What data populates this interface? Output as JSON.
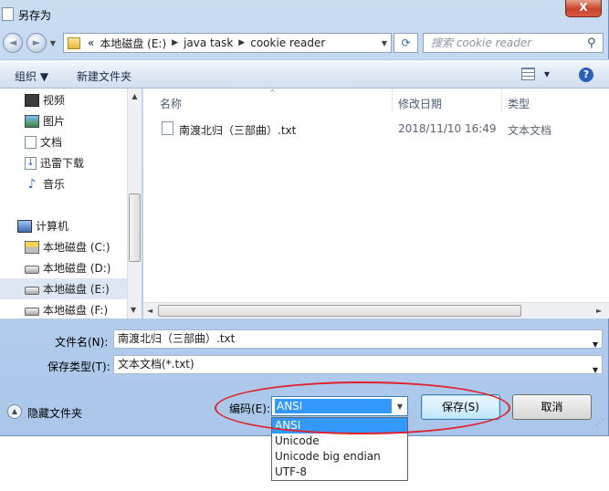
{
  "window": {
    "title": "另存为",
    "close_label": "X"
  },
  "nav": {
    "back_arrow": "◄",
    "fwd_arrow": "►",
    "address": {
      "prefix": "«",
      "crumbs": [
        "本地磁盘 (E:)",
        "java task",
        "cookie reader"
      ]
    },
    "search_placeholder": "搜索 cookie reader"
  },
  "toolbar": {
    "organize": "组织 ▼",
    "new_folder": "新建文件夹",
    "view_toggle": "▾"
  },
  "sidebar": {
    "items": [
      {
        "label": "视频",
        "icon": "video-icon"
      },
      {
        "label": "图片",
        "icon": "picture-icon"
      },
      {
        "label": "文档",
        "icon": "document-icon"
      },
      {
        "label": "迅雷下载",
        "icon": "download-icon"
      },
      {
        "label": "音乐",
        "icon": "music-icon"
      },
      {
        "label": "计算机",
        "icon": "computer-icon"
      },
      {
        "label": "本地磁盘 (C:)",
        "icon": "windows-drive-icon"
      },
      {
        "label": "本地磁盘 (D:)",
        "icon": "drive-icon"
      },
      {
        "label": "本地磁盘 (E:)",
        "icon": "drive-icon"
      },
      {
        "label": "本地磁盘 (F:)",
        "icon": "drive-icon"
      }
    ]
  },
  "file_list": {
    "columns": [
      "名称",
      "修改日期",
      "类型"
    ],
    "rows": [
      {
        "name": "南渡北归（三部曲）.txt",
        "date": "2018/11/10 16:49",
        "type": "文本文档"
      }
    ]
  },
  "form": {
    "filename_label": "文件名(N):",
    "filename_value": "南渡北归（三部曲）.txt",
    "filetype_label": "保存类型(T):",
    "filetype_value": "文本文档(*.txt)",
    "hide_folders": "隐藏文件夹",
    "encoding_label": "编码(E):",
    "encoding_value": "ANSI",
    "encoding_options": [
      "ANSI",
      "Unicode",
      "Unicode big endian",
      "UTF-8"
    ],
    "save_button": "保存(S)",
    "cancel_button": "取消"
  },
  "colors": {
    "selection": "#3399ff",
    "highlight_ellipse": "#e0212b",
    "frame": "#b7cfee"
  }
}
